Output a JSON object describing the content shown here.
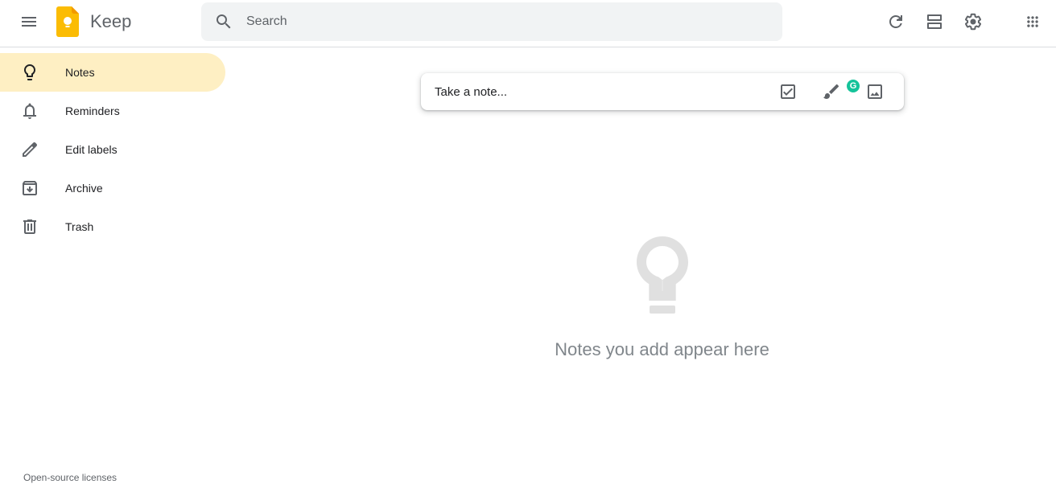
{
  "header": {
    "app_title": "Keep",
    "search_placeholder": "Search",
    "search_value": ""
  },
  "sidebar": {
    "items": [
      {
        "label": "Notes",
        "icon": "lightbulb-icon",
        "active": true
      },
      {
        "label": "Reminders",
        "icon": "bell-icon",
        "active": false
      },
      {
        "label": "Edit labels",
        "icon": "pencil-icon",
        "active": false
      },
      {
        "label": "Archive",
        "icon": "archive-icon",
        "active": false
      },
      {
        "label": "Trash",
        "icon": "trash-icon",
        "active": false
      }
    ],
    "footer_link": "Open-source licenses"
  },
  "note_input": {
    "placeholder": "Take a note...",
    "grammarly_badge": "G"
  },
  "empty_state": {
    "message": "Notes you add appear here"
  },
  "colors": {
    "accent_active": "#feefc3",
    "logo_yellow": "#fbbc04",
    "grammarly_green": "#15c39a"
  }
}
